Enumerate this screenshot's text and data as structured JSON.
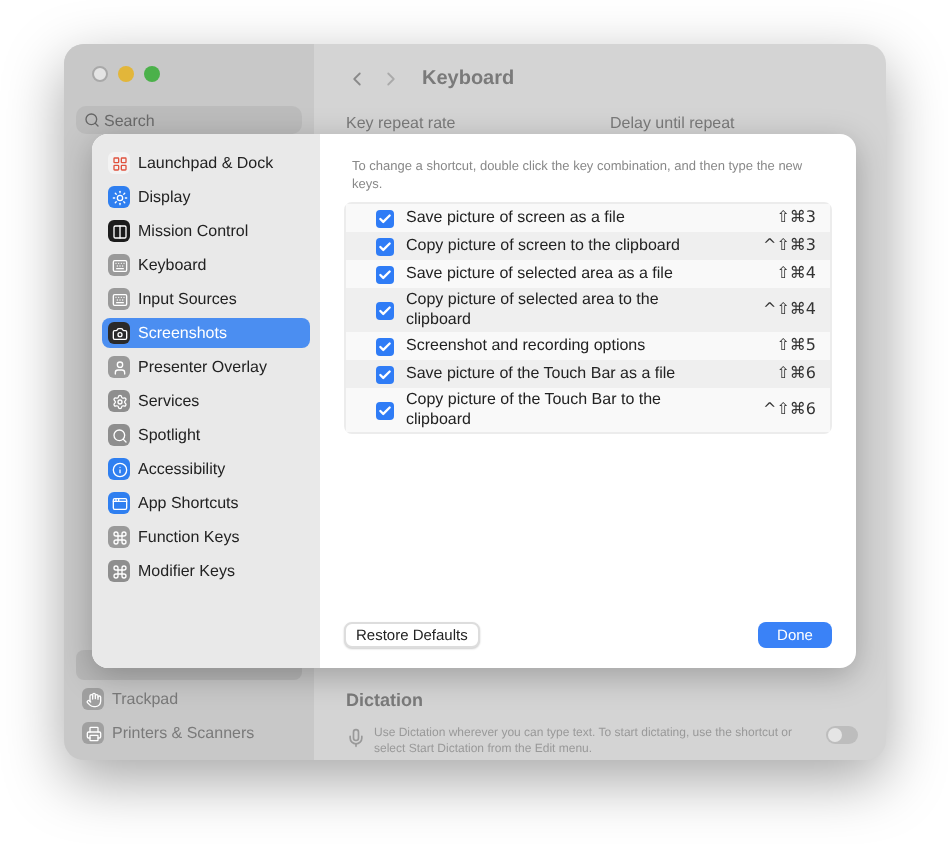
{
  "window": {
    "title": "Keyboard",
    "search": {
      "placeholder": "Search"
    }
  },
  "sidebar": {
    "items": [
      {
        "label": "Trackpad",
        "selected": false
      },
      {
        "label": "Printers & Scanners",
        "selected": false
      }
    ]
  },
  "settings": {
    "key_repeat_label": "Key repeat rate",
    "delay_label": "Delay until repeat",
    "dictation": {
      "title": "Dictation",
      "description": "Use Dictation wherever you can type text. To start dictating, use the shortcut or select Start Dictation from the Edit menu.",
      "on": false
    }
  },
  "sheet": {
    "categories": [
      {
        "label": "Launchpad & Dock",
        "selected": false
      },
      {
        "label": "Display",
        "selected": false
      },
      {
        "label": "Mission Control",
        "selected": false
      },
      {
        "label": "Keyboard",
        "selected": false
      },
      {
        "label": "Input Sources",
        "selected": false
      },
      {
        "label": "Screenshots",
        "selected": true
      },
      {
        "label": "Presenter Overlay",
        "selected": false
      },
      {
        "label": "Services",
        "selected": false
      },
      {
        "label": "Spotlight",
        "selected": false
      },
      {
        "label": "Accessibility",
        "selected": false
      },
      {
        "label": "App Shortcuts",
        "selected": false
      },
      {
        "label": "Function Keys",
        "selected": false
      },
      {
        "label": "Modifier Keys",
        "selected": false
      }
    ],
    "instructions": "To change a shortcut, double click the key combination, and then type the new keys.",
    "shortcuts": [
      {
        "label": "Save picture of screen as a file",
        "keys": "⇧⌘3",
        "checked": true
      },
      {
        "label": "Copy picture of screen to the clipboard",
        "keys": "^⇧⌘3",
        "checked": true
      },
      {
        "label": "Save picture of selected area as a file",
        "keys": "⇧⌘4",
        "checked": true
      },
      {
        "label": "Copy picture of selected area to the clipboard",
        "keys": "^⇧⌘4",
        "checked": true
      },
      {
        "label": "Screenshot and recording options",
        "keys": "⇧⌘5",
        "checked": true
      },
      {
        "label": "Save picture of the Touch Bar as a file",
        "keys": "⇧⌘6",
        "checked": true
      },
      {
        "label": "Copy picture of the Touch Bar to the clipboard",
        "keys": "^⇧⌘6",
        "checked": true
      }
    ],
    "buttons": {
      "restore": "Restore Defaults",
      "done": "Done"
    }
  }
}
